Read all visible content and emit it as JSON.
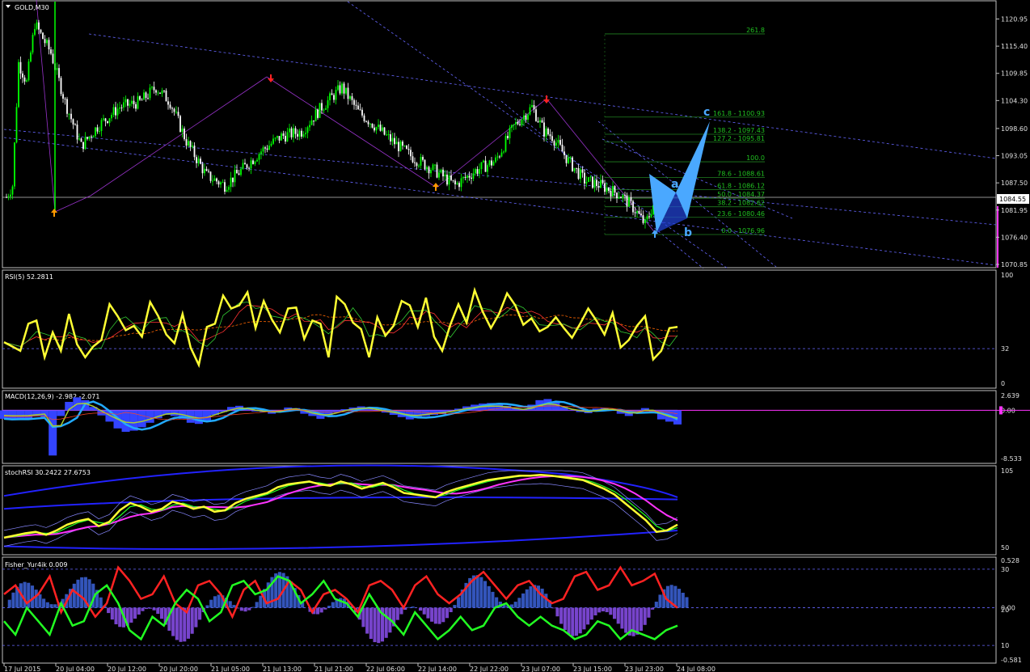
{
  "colors": {
    "background": "#000000",
    "frame": "#c0c0c0",
    "bull": "#00ff00",
    "bear": "#ffffff",
    "channel": "#6666ff",
    "fib": "#208020",
    "rsi": "#ffff33",
    "macd_hist": "#3344ff",
    "macd_line": "#22aaff",
    "signal": "#aacc33",
    "magenta": "#ff33ff",
    "fisher_red": "#ff2222",
    "fisher_green": "#22ff22",
    "fisher_hist": "#5566cc",
    "wave": "#4aa8ff",
    "arrow_up": "#ff9900",
    "arrow_down": "#ff2222"
  },
  "chart_data": [
    {
      "type": "candlestick",
      "title": "GOLD,M30",
      "ylim": [
        1070.85,
        1124.0
      ],
      "yticks": [
        "1120.95",
        "1115.40",
        "1109.85",
        "1104.30",
        "1098.60",
        "1093.05",
        "1087.50",
        "1081.95",
        "1076.40",
        "1070.85"
      ],
      "current_price": "1084.55",
      "close_path": [
        [
          0,
          1084.6
        ],
        [
          3,
          1087
        ],
        [
          6,
          1112
        ],
        [
          10,
          1108
        ],
        [
          14,
          1120
        ],
        [
          22,
          1114
        ],
        [
          29,
          1104
        ],
        [
          37,
          1095
        ],
        [
          45,
          1099
        ],
        [
          56,
          1103
        ],
        [
          66,
          1104
        ],
        [
          74,
          1107
        ],
        [
          81,
          1104
        ],
        [
          89,
          1096
        ],
        [
          99,
          1089
        ],
        [
          108,
          1087
        ],
        [
          116,
          1090
        ],
        [
          126,
          1094
        ],
        [
          136,
          1097
        ],
        [
          146,
          1098
        ],
        [
          156,
          1103
        ],
        [
          166,
          1107
        ],
        [
          174,
          1102
        ],
        [
          180,
          1100
        ],
        [
          188,
          1097
        ],
        [
          200,
          1093
        ],
        [
          212,
          1090
        ],
        [
          222,
          1087
        ],
        [
          232,
          1090
        ],
        [
          242,
          1092
        ],
        [
          251,
          1099
        ],
        [
          260,
          1103
        ],
        [
          266,
          1098
        ],
        [
          270,
          1097
        ],
        [
          278,
          1092
        ],
        [
          286,
          1088
        ],
        [
          294,
          1087
        ],
        [
          304,
          1085
        ],
        [
          311,
          1082
        ],
        [
          316,
          1079
        ],
        [
          320,
          1083
        ],
        [
          326,
          1084
        ]
      ],
      "x_date_labels": [
        "17 Jul 2015",
        "20 Jul 04:00",
        "20 Jul 12:00",
        "20 Jul 20:00",
        "21 Jul 05:00",
        "21 Jul 13:00",
        "21 Jul 21:00",
        "22 Jul 06:00",
        "22 Jul 14:00",
        "22 Jul 22:00",
        "23 Jul 07:00",
        "23 Jul 15:00",
        "23 Jul 23:00",
        "24 Jul 08:00"
      ],
      "fib_levels": [
        {
          "text": "261.8",
          "price": 1117.9
        },
        {
          "text": "161.8 - 1100.93",
          "price": 1100.93
        },
        {
          "text": "138.2 - 1097.43",
          "price": 1097.43
        },
        {
          "text": "127.2 - 1095.81",
          "price": 1095.81
        },
        {
          "text": "100.0",
          "price": 1091.8
        },
        {
          "text": "78.6 - 1088.61",
          "price": 1088.61
        },
        {
          "text": "61.8 - 1086.12",
          "price": 1086.12
        },
        {
          "text": "50.0 - 1084.37",
          "price": 1084.37
        },
        {
          "text": "38.2 - 1082.62",
          "price": 1082.62
        },
        {
          "text": "23.6 - 1080.46",
          "price": 1080.46
        },
        {
          "text": "0.0 - 1076.96",
          "price": 1076.96
        }
      ],
      "wave_labels": [
        "a",
        "b",
        "c"
      ]
    },
    {
      "type": "line",
      "title": "RSI(5) 52.2811",
      "ylim": [
        0,
        100
      ],
      "yticks": [
        "100",
        "32",
        "0"
      ],
      "level": 32,
      "series": [
        {
          "values": [
            38,
            34,
            30,
            55,
            58,
            24,
            47,
            30,
            64,
            36,
            24,
            34,
            40,
            73,
            62,
            49,
            53,
            43,
            75,
            62,
            45,
            37,
            64,
            33,
            17,
            52,
            55,
            81,
            69,
            72,
            84,
            51,
            76,
            59,
            47,
            69,
            70,
            41,
            58,
            55,
            24,
            80,
            73,
            56,
            50,
            24,
            61,
            44,
            53,
            76,
            72,
            52,
            79,
            43,
            30,
            54,
            73,
            56,
            86,
            66,
            51,
            64,
            83,
            72,
            54,
            60,
            48,
            52,
            61,
            51,
            42,
            55,
            69,
            58,
            45,
            65,
            33,
            40,
            53,
            62,
            22,
            30,
            51,
            52
          ]
        }
      ]
    },
    {
      "type": "bar",
      "title": "MACD(12,26,9) -2.982 -2.071",
      "yticks": [
        "2.639",
        "0.00",
        "-8.533"
      ],
      "ylim": [
        -8.533,
        2.639
      ],
      "series": [
        {
          "name": "histogram",
          "values": [
            -1.5,
            -1.7,
            -1.5,
            -1.6,
            -1.0,
            -1.2,
            -8.0,
            -1.0,
            1.5,
            2.3,
            1.8,
            0.6,
            -0.9,
            -2.0,
            -3.2,
            -3.8,
            -3.6,
            -3.0,
            -2.2,
            -1.4,
            -0.8,
            -1.0,
            -1.5,
            -2.2,
            -2.4,
            -1.8,
            -0.8,
            -0.3,
            0.6,
            0.8,
            0.3,
            -0.2,
            -0.3,
            -0.6,
            0.0,
            0.5,
            0.4,
            -0.6,
            -1.0,
            -1.5,
            -1.1,
            -0.4,
            0.2,
            0.5,
            0.7,
            0.5,
            0.0,
            -0.4,
            -0.8,
            -1.2,
            -1.6,
            -1.4,
            -1.0,
            -0.8,
            -0.6,
            -0.2,
            0.3,
            0.7,
            1.0,
            1.2,
            1.3,
            1.2,
            0.8,
            0.4,
            0.2,
            1.0,
            1.8,
            2.0,
            1.4,
            0.6,
            0.1,
            -0.3,
            -0.5,
            0.3,
            0.4,
            0.2,
            -0.6,
            -1.0,
            -0.4,
            0.4,
            -0.4,
            -1.6,
            -2.0,
            -2.5
          ]
        }
      ]
    },
    {
      "type": "line",
      "title": "stochRSI 30.2422 27.6753",
      "yticks": [
        "105",
        "50"
      ],
      "ylim": [
        -5,
        105
      ],
      "series": [
        {
          "values": [
            12,
            15,
            18,
            20,
            16,
            22,
            30,
            35,
            38,
            28,
            34,
            50,
            60,
            55,
            48,
            52,
            62,
            58,
            52,
            55,
            48,
            50,
            60,
            66,
            70,
            74,
            82,
            86,
            88,
            90,
            86,
            84,
            90,
            86,
            80,
            84,
            88,
            82,
            74,
            72,
            70,
            68,
            75,
            80,
            84,
            88,
            92,
            94,
            96,
            98,
            98,
            99,
            98,
            96,
            94,
            92,
            86,
            80,
            72,
            60,
            48,
            36,
            20,
            22,
            30
          ]
        }
      ]
    },
    {
      "type": "line",
      "title": "Fisher_Yur4ik 0.009",
      "yticks": [
        "0.528",
        "30",
        "0.00",
        "20",
        "10",
        "-0.581"
      ],
      "ylim": [
        -0.581,
        0.528
      ],
      "series": [
        {
          "name": "red",
          "values": [
            0.15,
            0.25,
            0.05,
            0.15,
            0.35,
            -0.05,
            0.2,
            0.1,
            -0.1,
            0.05,
            0.45,
            0.3,
            0.1,
            0.15,
            0.35,
            0.05,
            -0.05,
            0.25,
            0.3,
            0.15,
            -0.1,
            0.2,
            0.3,
            0.05,
            0.1,
            0.3,
            0.2,
            -0.05,
            0.15,
            0.2,
            0.1,
            -0.05,
            0.25,
            0.3,
            0.2,
            0.0,
            0.25,
            0.35,
            0.15,
            0.05,
            0.15,
            0.3,
            0.4,
            0.25,
            0.1,
            0.25,
            0.3,
            0.15,
            0.05,
            0.1,
            0.35,
            0.4,
            0.2,
            0.25,
            0.45,
            0.25,
            0.3,
            0.38,
            0.1,
            0.0
          ]
        },
        {
          "name": "green",
          "values": [
            -0.15,
            -0.3,
            0.0,
            -0.15,
            -0.3,
            0.05,
            -0.2,
            -0.15,
            0.15,
            0.25,
            0.05,
            -0.25,
            -0.35,
            -0.1,
            -0.2,
            0.05,
            0.2,
            0.1,
            -0.15,
            -0.05,
            0.25,
            0.3,
            0.15,
            0.2,
            0.35,
            0.3,
            0.05,
            0.15,
            0.3,
            0.1,
            0.05,
            -0.1,
            0.15,
            -0.05,
            -0.15,
            -0.3,
            -0.05,
            -0.2,
            -0.35,
            -0.25,
            -0.1,
            -0.25,
            -0.2,
            0.0,
            0.05,
            -0.1,
            -0.2,
            -0.1,
            -0.2,
            -0.25,
            -0.35,
            -0.3,
            -0.15,
            -0.2,
            -0.35,
            -0.25,
            -0.3,
            -0.35,
            -0.25,
            -0.2
          ]
        }
      ]
    }
  ]
}
